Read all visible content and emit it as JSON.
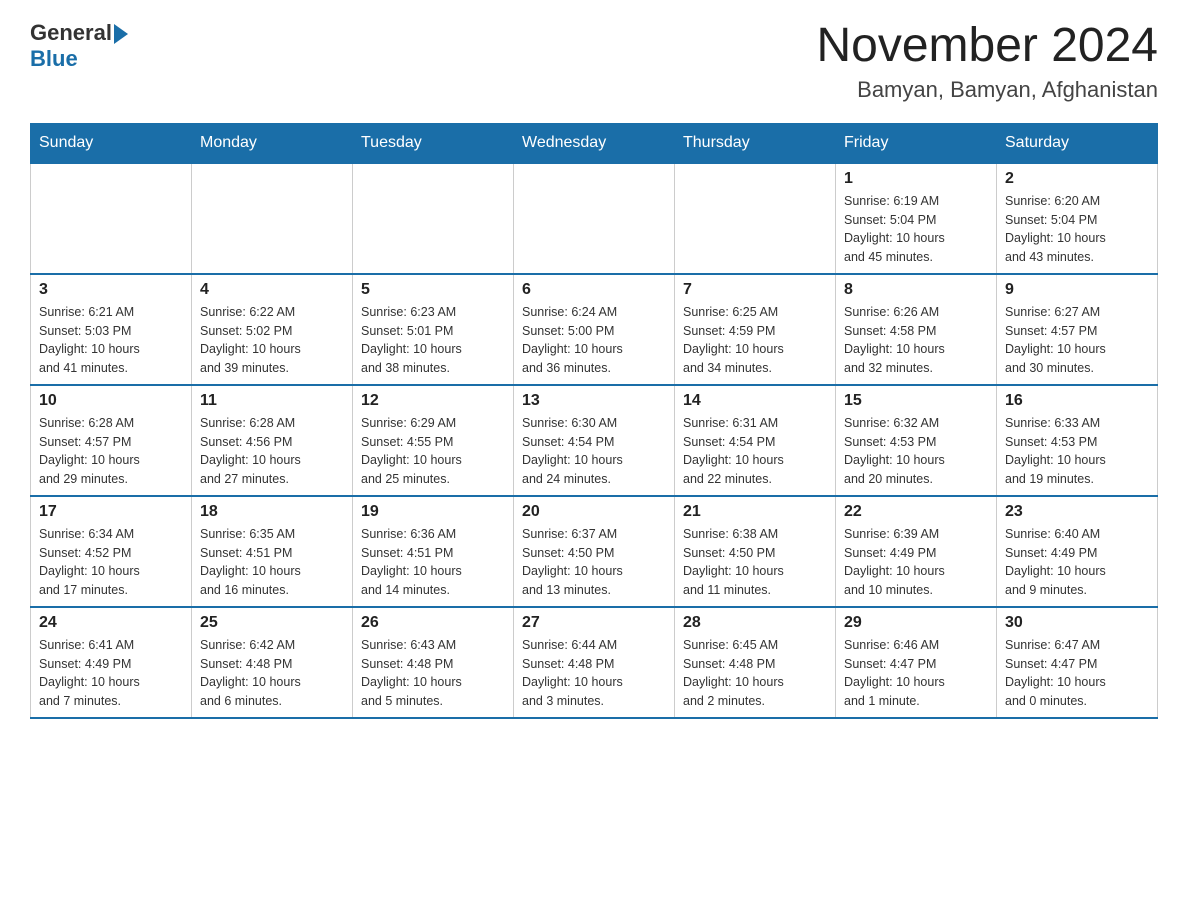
{
  "header": {
    "logo_general": "General",
    "logo_blue": "Blue",
    "month_title": "November 2024",
    "location": "Bamyan, Bamyan, Afghanistan"
  },
  "weekdays": [
    "Sunday",
    "Monday",
    "Tuesday",
    "Wednesday",
    "Thursday",
    "Friday",
    "Saturday"
  ],
  "weeks": [
    [
      {
        "day": "",
        "info": ""
      },
      {
        "day": "",
        "info": ""
      },
      {
        "day": "",
        "info": ""
      },
      {
        "day": "",
        "info": ""
      },
      {
        "day": "",
        "info": ""
      },
      {
        "day": "1",
        "info": "Sunrise: 6:19 AM\nSunset: 5:04 PM\nDaylight: 10 hours\nand 45 minutes."
      },
      {
        "day": "2",
        "info": "Sunrise: 6:20 AM\nSunset: 5:04 PM\nDaylight: 10 hours\nand 43 minutes."
      }
    ],
    [
      {
        "day": "3",
        "info": "Sunrise: 6:21 AM\nSunset: 5:03 PM\nDaylight: 10 hours\nand 41 minutes."
      },
      {
        "day": "4",
        "info": "Sunrise: 6:22 AM\nSunset: 5:02 PM\nDaylight: 10 hours\nand 39 minutes."
      },
      {
        "day": "5",
        "info": "Sunrise: 6:23 AM\nSunset: 5:01 PM\nDaylight: 10 hours\nand 38 minutes."
      },
      {
        "day": "6",
        "info": "Sunrise: 6:24 AM\nSunset: 5:00 PM\nDaylight: 10 hours\nand 36 minutes."
      },
      {
        "day": "7",
        "info": "Sunrise: 6:25 AM\nSunset: 4:59 PM\nDaylight: 10 hours\nand 34 minutes."
      },
      {
        "day": "8",
        "info": "Sunrise: 6:26 AM\nSunset: 4:58 PM\nDaylight: 10 hours\nand 32 minutes."
      },
      {
        "day": "9",
        "info": "Sunrise: 6:27 AM\nSunset: 4:57 PM\nDaylight: 10 hours\nand 30 minutes."
      }
    ],
    [
      {
        "day": "10",
        "info": "Sunrise: 6:28 AM\nSunset: 4:57 PM\nDaylight: 10 hours\nand 29 minutes."
      },
      {
        "day": "11",
        "info": "Sunrise: 6:28 AM\nSunset: 4:56 PM\nDaylight: 10 hours\nand 27 minutes."
      },
      {
        "day": "12",
        "info": "Sunrise: 6:29 AM\nSunset: 4:55 PM\nDaylight: 10 hours\nand 25 minutes."
      },
      {
        "day": "13",
        "info": "Sunrise: 6:30 AM\nSunset: 4:54 PM\nDaylight: 10 hours\nand 24 minutes."
      },
      {
        "day": "14",
        "info": "Sunrise: 6:31 AM\nSunset: 4:54 PM\nDaylight: 10 hours\nand 22 minutes."
      },
      {
        "day": "15",
        "info": "Sunrise: 6:32 AM\nSunset: 4:53 PM\nDaylight: 10 hours\nand 20 minutes."
      },
      {
        "day": "16",
        "info": "Sunrise: 6:33 AM\nSunset: 4:53 PM\nDaylight: 10 hours\nand 19 minutes."
      }
    ],
    [
      {
        "day": "17",
        "info": "Sunrise: 6:34 AM\nSunset: 4:52 PM\nDaylight: 10 hours\nand 17 minutes."
      },
      {
        "day": "18",
        "info": "Sunrise: 6:35 AM\nSunset: 4:51 PM\nDaylight: 10 hours\nand 16 minutes."
      },
      {
        "day": "19",
        "info": "Sunrise: 6:36 AM\nSunset: 4:51 PM\nDaylight: 10 hours\nand 14 minutes."
      },
      {
        "day": "20",
        "info": "Sunrise: 6:37 AM\nSunset: 4:50 PM\nDaylight: 10 hours\nand 13 minutes."
      },
      {
        "day": "21",
        "info": "Sunrise: 6:38 AM\nSunset: 4:50 PM\nDaylight: 10 hours\nand 11 minutes."
      },
      {
        "day": "22",
        "info": "Sunrise: 6:39 AM\nSunset: 4:49 PM\nDaylight: 10 hours\nand 10 minutes."
      },
      {
        "day": "23",
        "info": "Sunrise: 6:40 AM\nSunset: 4:49 PM\nDaylight: 10 hours\nand 9 minutes."
      }
    ],
    [
      {
        "day": "24",
        "info": "Sunrise: 6:41 AM\nSunset: 4:49 PM\nDaylight: 10 hours\nand 7 minutes."
      },
      {
        "day": "25",
        "info": "Sunrise: 6:42 AM\nSunset: 4:48 PM\nDaylight: 10 hours\nand 6 minutes."
      },
      {
        "day": "26",
        "info": "Sunrise: 6:43 AM\nSunset: 4:48 PM\nDaylight: 10 hours\nand 5 minutes."
      },
      {
        "day": "27",
        "info": "Sunrise: 6:44 AM\nSunset: 4:48 PM\nDaylight: 10 hours\nand 3 minutes."
      },
      {
        "day": "28",
        "info": "Sunrise: 6:45 AM\nSunset: 4:48 PM\nDaylight: 10 hours\nand 2 minutes."
      },
      {
        "day": "29",
        "info": "Sunrise: 6:46 AM\nSunset: 4:47 PM\nDaylight: 10 hours\nand 1 minute."
      },
      {
        "day": "30",
        "info": "Sunrise: 6:47 AM\nSunset: 4:47 PM\nDaylight: 10 hours\nand 0 minutes."
      }
    ]
  ]
}
